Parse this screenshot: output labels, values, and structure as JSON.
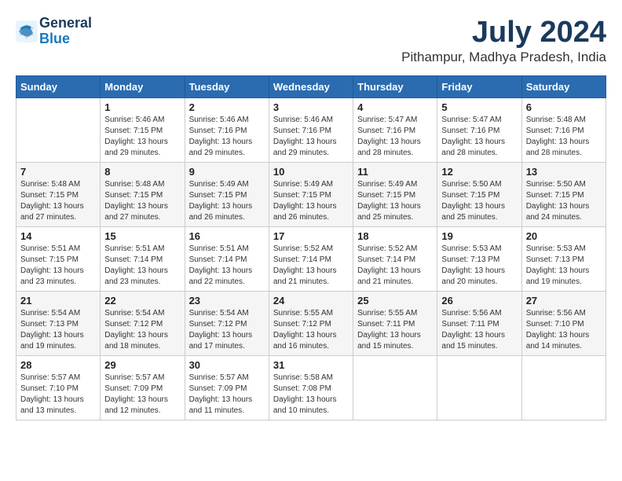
{
  "app": {
    "logo_line1": "General",
    "logo_line2": "Blue",
    "month_title": "July 2024",
    "location": "Pithampur, Madhya Pradesh, India"
  },
  "calendar": {
    "headers": [
      "Sunday",
      "Monday",
      "Tuesday",
      "Wednesday",
      "Thursday",
      "Friday",
      "Saturday"
    ],
    "weeks": [
      [
        {
          "day": "",
          "info": ""
        },
        {
          "day": "1",
          "info": "Sunrise: 5:46 AM\nSunset: 7:15 PM\nDaylight: 13 hours\nand 29 minutes."
        },
        {
          "day": "2",
          "info": "Sunrise: 5:46 AM\nSunset: 7:16 PM\nDaylight: 13 hours\nand 29 minutes."
        },
        {
          "day": "3",
          "info": "Sunrise: 5:46 AM\nSunset: 7:16 PM\nDaylight: 13 hours\nand 29 minutes."
        },
        {
          "day": "4",
          "info": "Sunrise: 5:47 AM\nSunset: 7:16 PM\nDaylight: 13 hours\nand 28 minutes."
        },
        {
          "day": "5",
          "info": "Sunrise: 5:47 AM\nSunset: 7:16 PM\nDaylight: 13 hours\nand 28 minutes."
        },
        {
          "day": "6",
          "info": "Sunrise: 5:48 AM\nSunset: 7:16 PM\nDaylight: 13 hours\nand 28 minutes."
        }
      ],
      [
        {
          "day": "7",
          "info": "Sunrise: 5:48 AM\nSunset: 7:15 PM\nDaylight: 13 hours\nand 27 minutes."
        },
        {
          "day": "8",
          "info": "Sunrise: 5:48 AM\nSunset: 7:15 PM\nDaylight: 13 hours\nand 27 minutes."
        },
        {
          "day": "9",
          "info": "Sunrise: 5:49 AM\nSunset: 7:15 PM\nDaylight: 13 hours\nand 26 minutes."
        },
        {
          "day": "10",
          "info": "Sunrise: 5:49 AM\nSunset: 7:15 PM\nDaylight: 13 hours\nand 26 minutes."
        },
        {
          "day": "11",
          "info": "Sunrise: 5:49 AM\nSunset: 7:15 PM\nDaylight: 13 hours\nand 25 minutes."
        },
        {
          "day": "12",
          "info": "Sunrise: 5:50 AM\nSunset: 7:15 PM\nDaylight: 13 hours\nand 25 minutes."
        },
        {
          "day": "13",
          "info": "Sunrise: 5:50 AM\nSunset: 7:15 PM\nDaylight: 13 hours\nand 24 minutes."
        }
      ],
      [
        {
          "day": "14",
          "info": "Sunrise: 5:51 AM\nSunset: 7:15 PM\nDaylight: 13 hours\nand 23 minutes."
        },
        {
          "day": "15",
          "info": "Sunrise: 5:51 AM\nSunset: 7:14 PM\nDaylight: 13 hours\nand 23 minutes."
        },
        {
          "day": "16",
          "info": "Sunrise: 5:51 AM\nSunset: 7:14 PM\nDaylight: 13 hours\nand 22 minutes."
        },
        {
          "day": "17",
          "info": "Sunrise: 5:52 AM\nSunset: 7:14 PM\nDaylight: 13 hours\nand 21 minutes."
        },
        {
          "day": "18",
          "info": "Sunrise: 5:52 AM\nSunset: 7:14 PM\nDaylight: 13 hours\nand 21 minutes."
        },
        {
          "day": "19",
          "info": "Sunrise: 5:53 AM\nSunset: 7:13 PM\nDaylight: 13 hours\nand 20 minutes."
        },
        {
          "day": "20",
          "info": "Sunrise: 5:53 AM\nSunset: 7:13 PM\nDaylight: 13 hours\nand 19 minutes."
        }
      ],
      [
        {
          "day": "21",
          "info": "Sunrise: 5:54 AM\nSunset: 7:13 PM\nDaylight: 13 hours\nand 19 minutes."
        },
        {
          "day": "22",
          "info": "Sunrise: 5:54 AM\nSunset: 7:12 PM\nDaylight: 13 hours\nand 18 minutes."
        },
        {
          "day": "23",
          "info": "Sunrise: 5:54 AM\nSunset: 7:12 PM\nDaylight: 13 hours\nand 17 minutes."
        },
        {
          "day": "24",
          "info": "Sunrise: 5:55 AM\nSunset: 7:12 PM\nDaylight: 13 hours\nand 16 minutes."
        },
        {
          "day": "25",
          "info": "Sunrise: 5:55 AM\nSunset: 7:11 PM\nDaylight: 13 hours\nand 15 minutes."
        },
        {
          "day": "26",
          "info": "Sunrise: 5:56 AM\nSunset: 7:11 PM\nDaylight: 13 hours\nand 15 minutes."
        },
        {
          "day": "27",
          "info": "Sunrise: 5:56 AM\nSunset: 7:10 PM\nDaylight: 13 hours\nand 14 minutes."
        }
      ],
      [
        {
          "day": "28",
          "info": "Sunrise: 5:57 AM\nSunset: 7:10 PM\nDaylight: 13 hours\nand 13 minutes."
        },
        {
          "day": "29",
          "info": "Sunrise: 5:57 AM\nSunset: 7:09 PM\nDaylight: 13 hours\nand 12 minutes."
        },
        {
          "day": "30",
          "info": "Sunrise: 5:57 AM\nSunset: 7:09 PM\nDaylight: 13 hours\nand 11 minutes."
        },
        {
          "day": "31",
          "info": "Sunrise: 5:58 AM\nSunset: 7:08 PM\nDaylight: 13 hours\nand 10 minutes."
        },
        {
          "day": "",
          "info": ""
        },
        {
          "day": "",
          "info": ""
        },
        {
          "day": "",
          "info": ""
        }
      ]
    ]
  }
}
